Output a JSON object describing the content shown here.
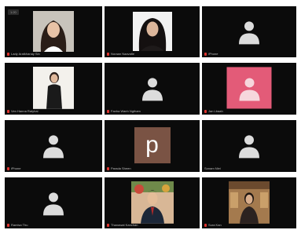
{
  "window": {
    "badge": "1:20"
  },
  "participants": [
    {
      "name": "Lady Aratkhanay Sin",
      "avatar": "photo-woman-long-hair",
      "muted": true
    },
    {
      "name": "Noraan Naavalte",
      "avatar": "photo-woman-dark-hair",
      "muted": true
    },
    {
      "name": "iPhone",
      "avatar": "default-person",
      "muted": true
    },
    {
      "name": "Ven Hanna Ratyhai",
      "avatar": "photo-woman-standing",
      "muted": true
    },
    {
      "name": "Fanha Wanh Ngtham",
      "avatar": "default-person",
      "muted": true
    },
    {
      "name": "Jan Lbaah",
      "avatar": "default-person-pink",
      "muted": true
    },
    {
      "name": "iPhone",
      "avatar": "default-person",
      "muted": true
    },
    {
      "name": "Parada Sheen",
      "avatar": "letter",
      "letter": "p",
      "muted": true
    },
    {
      "name": "Sonam Nlei",
      "avatar": "default-person",
      "muted": false
    },
    {
      "name": "Ramisa Thu",
      "avatar": "default-person",
      "muted": true
    },
    {
      "name": "Thanawat Kanchan",
      "avatar": "photo-man-suit",
      "muted": true
    },
    {
      "name": "Sura Kan",
      "avatar": "photo-woman-room",
      "muted": true
    }
  ],
  "colors": {
    "tile_bg": "#0b0b0b",
    "mic_muted": "#e0332e",
    "letter_bg": "#7a5344",
    "pink_bg": "#e35b78"
  }
}
